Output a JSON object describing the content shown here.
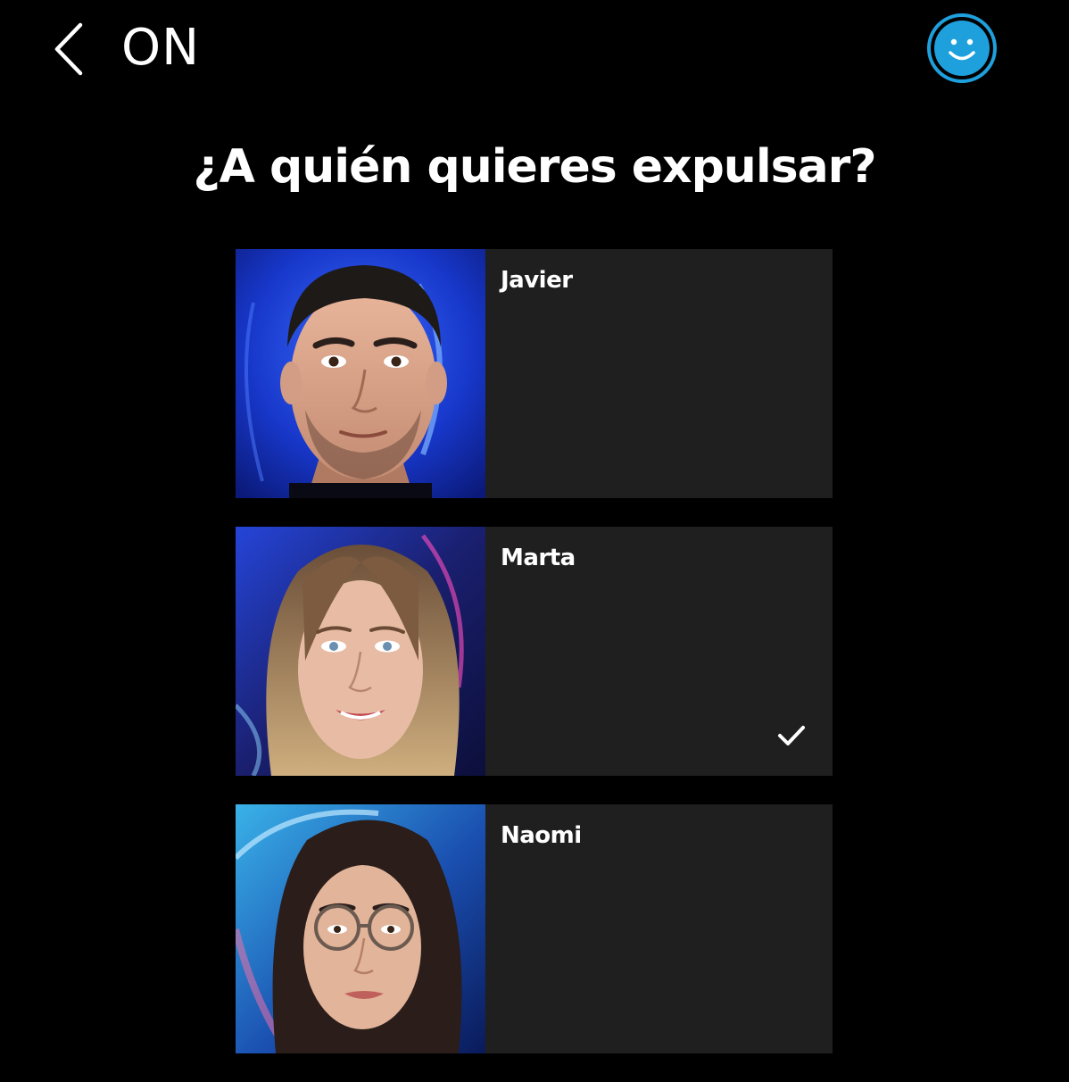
{
  "header": {
    "back_icon": "chevron-left-icon",
    "title": "ON",
    "avatar_icon": "smiley-face-icon",
    "avatar_color": "#1ea0dc"
  },
  "question": "¿A quién quieres expulsar?",
  "candidates": [
    {
      "name": "Javier",
      "selected": false,
      "photo": "portrait-man"
    },
    {
      "name": "Marta",
      "selected": true,
      "photo": "portrait-woman-long-hair"
    },
    {
      "name": "Naomi",
      "selected": false,
      "photo": "portrait-woman-glasses"
    }
  ],
  "selected_icon": "checkmark-icon",
  "colors": {
    "background": "#000000",
    "card": "#1f1f1f",
    "text": "#ffffff",
    "accent": "#1ea0dc"
  }
}
